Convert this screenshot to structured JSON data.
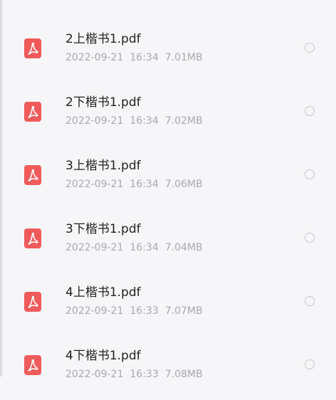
{
  "files": [
    {
      "name": "2上楷书1.pdf",
      "date": "2022-09-21",
      "time": "16:34",
      "size": "7.01MB",
      "icon": "pdf-icon"
    },
    {
      "name": "2下楷书1.pdf",
      "date": "2022-09-21",
      "time": "16:34",
      "size": "7.02MB",
      "icon": "pdf-icon"
    },
    {
      "name": "3上楷书1.pdf",
      "date": "2022-09-21",
      "time": "16:34",
      "size": "7.06MB",
      "icon": "pdf-icon"
    },
    {
      "name": "3下楷书1.pdf",
      "date": "2022-09-21",
      "time": "16:34",
      "size": "7.04MB",
      "icon": "pdf-icon"
    },
    {
      "name": "4上楷书1.pdf",
      "date": "2022-09-21",
      "time": "16:33",
      "size": "7.07MB",
      "icon": "pdf-icon"
    },
    {
      "name": "4下楷书1.pdf",
      "date": "2022-09-21",
      "time": "16:33",
      "size": "7.08MB",
      "icon": "pdf-icon"
    }
  ],
  "colors": {
    "background": "#f6f6f8",
    "pdf_icon": "#f05a5a",
    "file_name": "#222222",
    "meta_text": "#a9a9ad",
    "radio_border": "#c8c8cc"
  }
}
